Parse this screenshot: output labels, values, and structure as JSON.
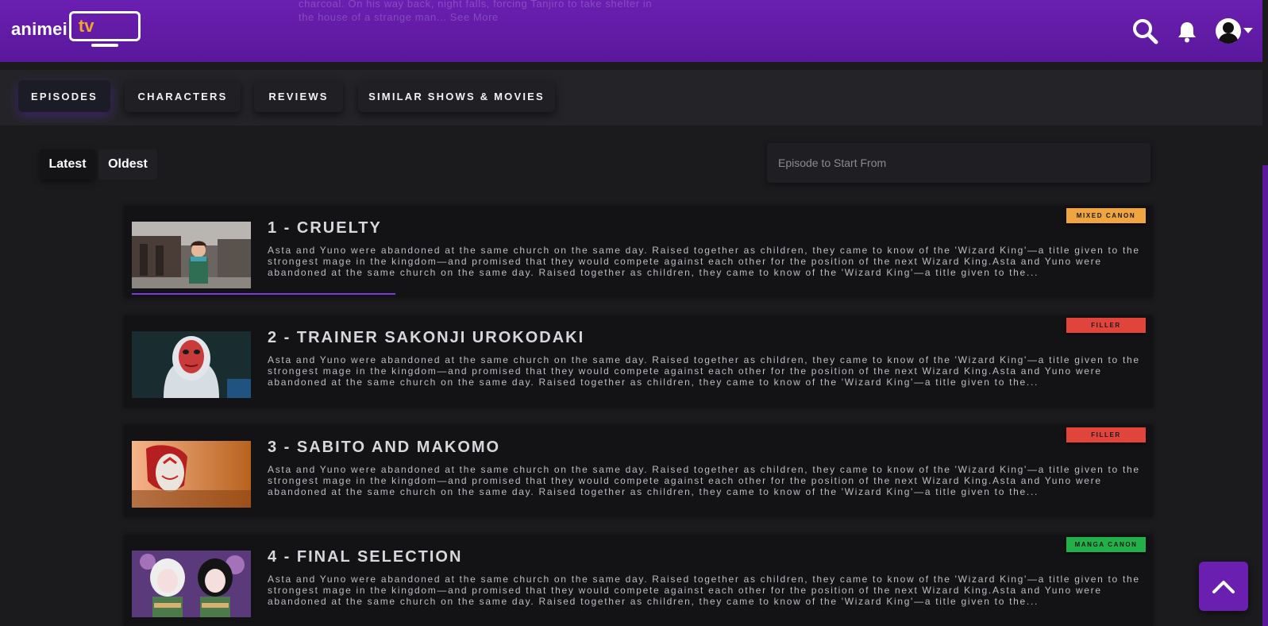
{
  "header": {
    "logo_text": "animei",
    "logo_tv": "tv",
    "bleed_text": "charcoal. On his way back, night falls, forcing Tanjiro to take shelter in the house of a strange man...  See More"
  },
  "tabs": [
    {
      "label": "EPISODES",
      "active": true
    },
    {
      "label": "CHARACTERS",
      "active": false
    },
    {
      "label": "REVIEWS",
      "active": false
    },
    {
      "label": "SIMILAR SHOWS & MOVIES",
      "active": false
    }
  ],
  "sort": {
    "latest_label": "Latest",
    "oldest_label": "Oldest"
  },
  "episode_input": {
    "placeholder": "Episode to Start From"
  },
  "episodes": [
    {
      "title": "1 - CRUELTY",
      "badge": "MIXED CANON",
      "badge_color": "#f0a540",
      "progress": 0.26,
      "description": "Asta and Yuno were abandoned at the same church on the same day. Raised together as children, they came to know of the 'Wizard King'—a title given to the strongest mage in the kingdom—and promised that they would compete against each other for the position of the next Wizard King.Asta and Yuno were abandoned at the same church on the same day. Raised together as children, they came to know of the 'Wizard King'—a title given to the..."
    },
    {
      "title": "2 - TRAINER SAKONJI UROKODAKI",
      "badge": "FILLER",
      "badge_color": "#e0443a",
      "description": "Asta and Yuno were abandoned at the same church on the same day. Raised together as children, they came to know of the 'Wizard King'—a title given to the strongest mage in the kingdom—and promised that they would compete against each other for the position of the next Wizard King.Asta and Yuno were abandoned at the same church on the same day. Raised together as children, they came to know of the 'Wizard King'—a title given to the..."
    },
    {
      "title": "3 - SABITO AND MAKOMO",
      "badge": "FILLER",
      "badge_color": "#e0443a",
      "description": "Asta and Yuno were abandoned at the same church on the same day. Raised together as children, they came to know of the 'Wizard King'—a title given to the strongest mage in the kingdom—and promised that they would compete against each other for the position of the next Wizard King.Asta and Yuno were abandoned at the same church on the same day. Raised together as children, they came to know of the 'Wizard King'—a title given to the..."
    },
    {
      "title": "4 - FINAL SELECTION",
      "badge": "MANGA CANON",
      "badge_color": "#22b04a",
      "description": "Asta and Yuno were abandoned at the same church on the same day. Raised together as children, they came to know of the 'Wizard King'—a title given to the strongest mage in the kingdom—and promised that they would compete against each other for the position of the next Wizard King.Asta and Yuno were abandoned at the same church on the same day. Raised together as children, they came to know of the 'Wizard King'—a title given to the..."
    }
  ],
  "icons": {
    "search": "search-icon",
    "notifications": "bell-icon",
    "account": "avatar-icon",
    "account_menu": "chevron-down-icon",
    "scroll_top": "chevron-up-icon"
  },
  "colors": {
    "brand_purple": "#6a1fb0",
    "logo_accent": "#f0a52e",
    "progress": "#7a3ae0"
  }
}
